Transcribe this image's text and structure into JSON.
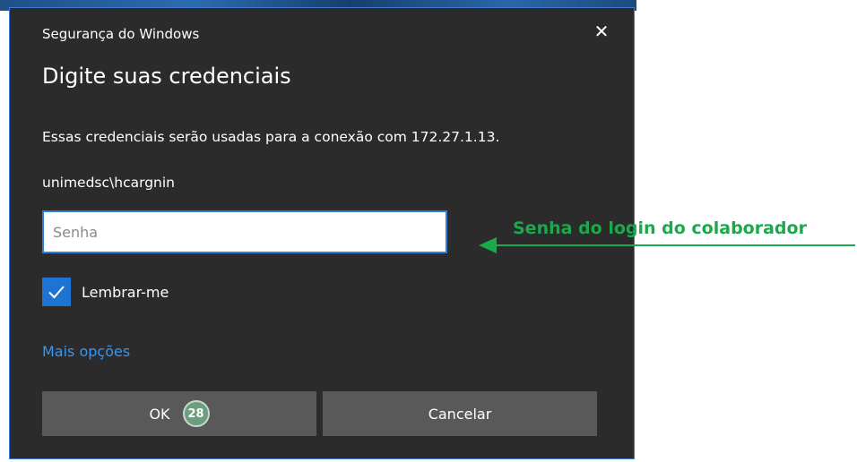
{
  "dialog": {
    "window_title": "Segurança do Windows",
    "close_glyph": "✕",
    "heading": "Digite suas credenciais",
    "description": "Essas credenciais serão usadas para a conexão com 172.27.1.13.",
    "username": "unimedsc\\hcargnin",
    "password": {
      "value": "",
      "placeholder": "Senha"
    },
    "remember_me": {
      "label": "Lembrar-me",
      "checked": true
    },
    "more_options_label": "Mais opções",
    "ok_button": {
      "label": "OK",
      "badge": "28"
    },
    "cancel_button": {
      "label": "Cancelar"
    }
  },
  "annotation": {
    "text": "Senha do login do colaborador",
    "color": "#1aa94d"
  },
  "colors": {
    "dialog_background": "#2b2b2b",
    "accent": "#1e74d2",
    "link": "#3a96f0",
    "button": "#595959"
  },
  "icons": {
    "close": "close-icon",
    "checkbox": "checkmark-icon",
    "arrow": "arrow-left-icon"
  }
}
